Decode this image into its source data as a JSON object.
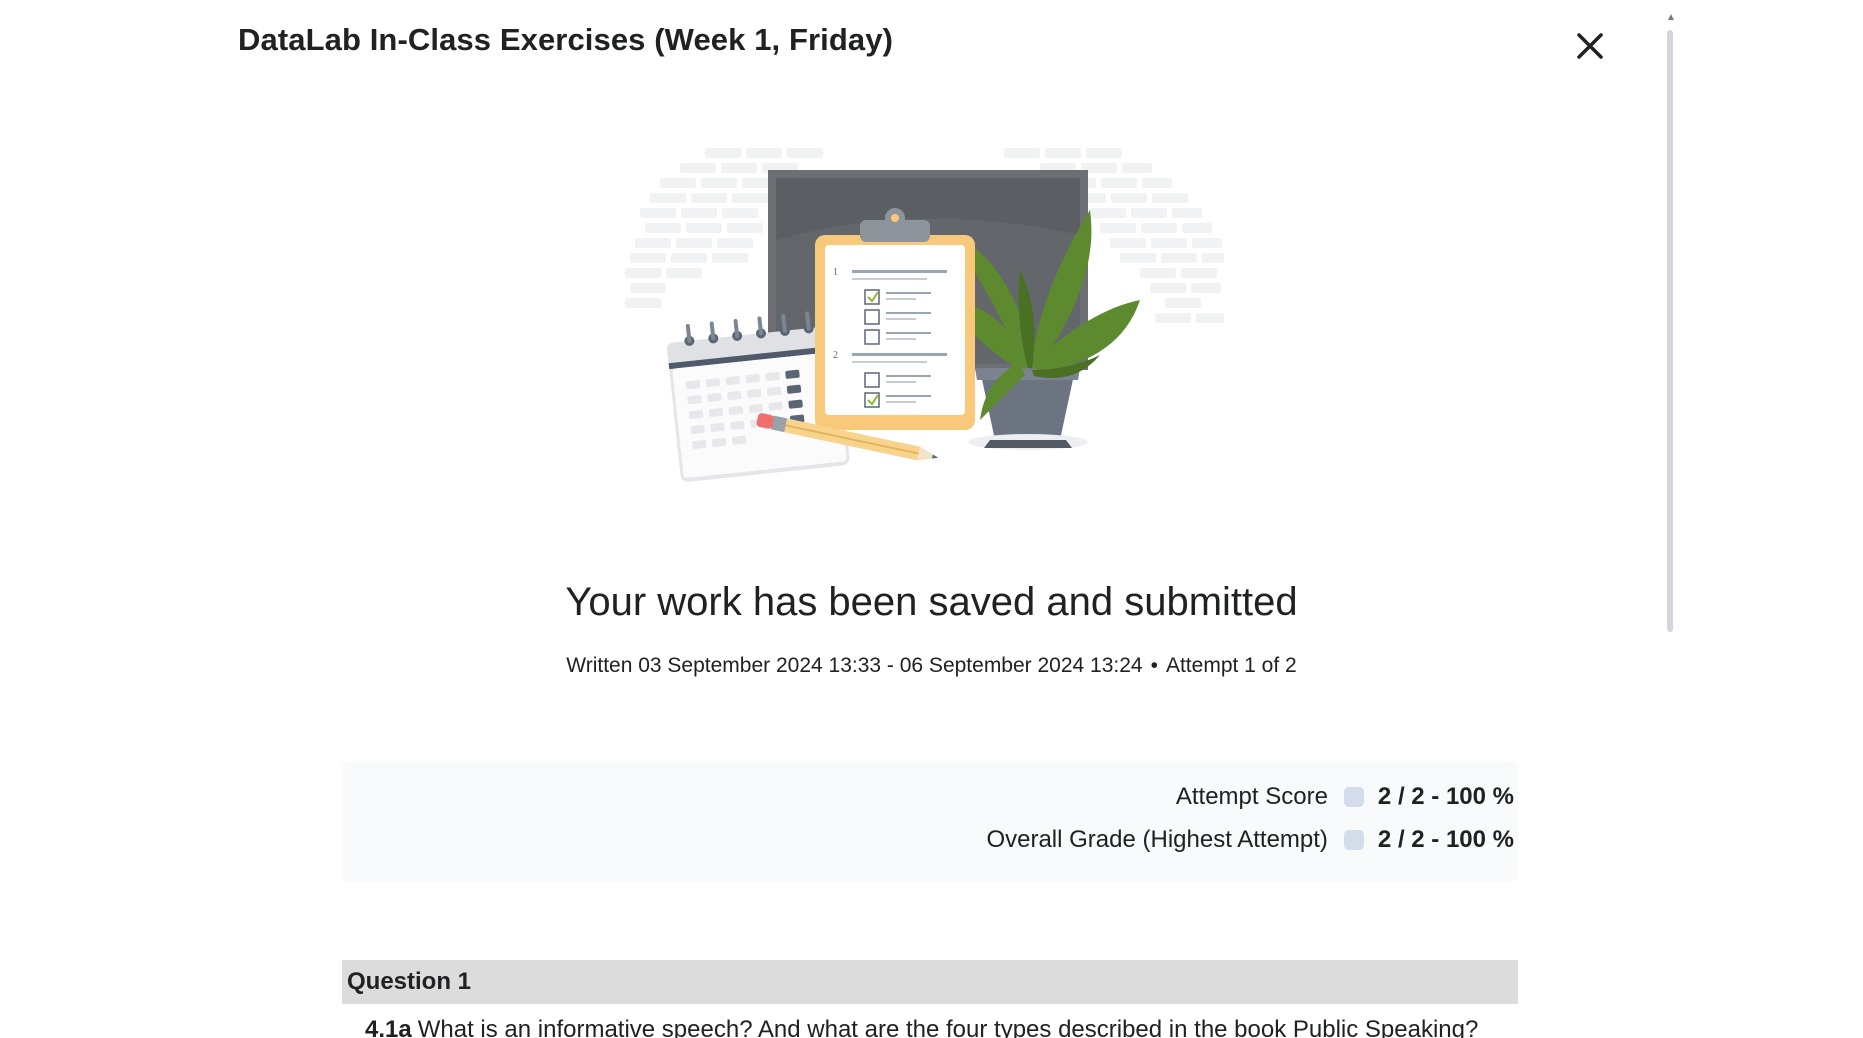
{
  "dialog": {
    "title": "DataLab In-Class Exercises (Week 1, Friday)",
    "close_icon": "close-icon"
  },
  "confirmation": {
    "headline": "Your work has been saved and submitted",
    "written": "Written 03 September 2024 13:33 - 06 September 2024 13:24",
    "separator": "•",
    "attempt": "Attempt 1 of 2"
  },
  "scores": {
    "attempt_label": "Attempt Score",
    "attempt_value": "2 / 2 - 100 %",
    "overall_label": "Overall Grade (Highest Attempt)",
    "overall_value": "2 / 2 - 100 %"
  },
  "question": {
    "header": "Question 1",
    "number": "4.1a",
    "text": "What is an informative speech? And what are the four types described in the book Public Speaking?"
  },
  "illustration": {
    "list_numbers": [
      "1",
      "2"
    ]
  },
  "colors": {
    "panel_bg": "#f9fafc",
    "question_header_bg": "#dcdcdc",
    "indicator": "#d3dcea",
    "clipboard": "#f8c97a",
    "plant": "#5d8a2e",
    "pot": "#6b7480"
  }
}
